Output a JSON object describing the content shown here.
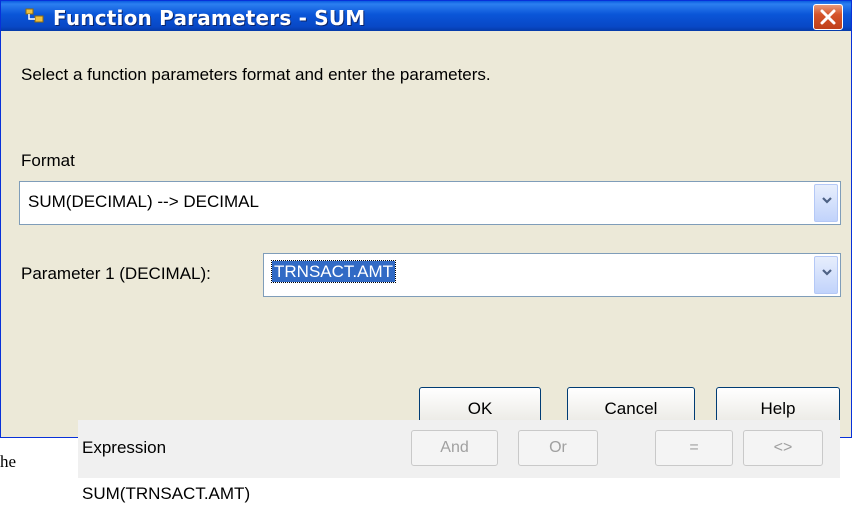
{
  "window": {
    "title": "Function Parameters - SUM",
    "icon": "function-icon"
  },
  "instruction": "Select a function parameters format and enter the parameters.",
  "format": {
    "label": "Format",
    "value": "SUM(DECIMAL)  -->  DECIMAL"
  },
  "parameter1": {
    "label": "Parameter 1 (DECIMAL):",
    "value": "TRNSACT.AMT"
  },
  "buttons": {
    "ok": "OK",
    "cancel": "Cancel",
    "help": "Help"
  },
  "expression": {
    "label": "Expression",
    "value": "SUM(TRNSACT.AMT)",
    "buttons": {
      "and": "And",
      "or": "Or",
      "eq": "=",
      "ne": "<>"
    }
  },
  "background_fragment": "he",
  "colors": {
    "titlebar": "#0a55d8",
    "dialog_bg": "#ece9d8",
    "selection": "#316ac5",
    "close": "#d5542a"
  }
}
